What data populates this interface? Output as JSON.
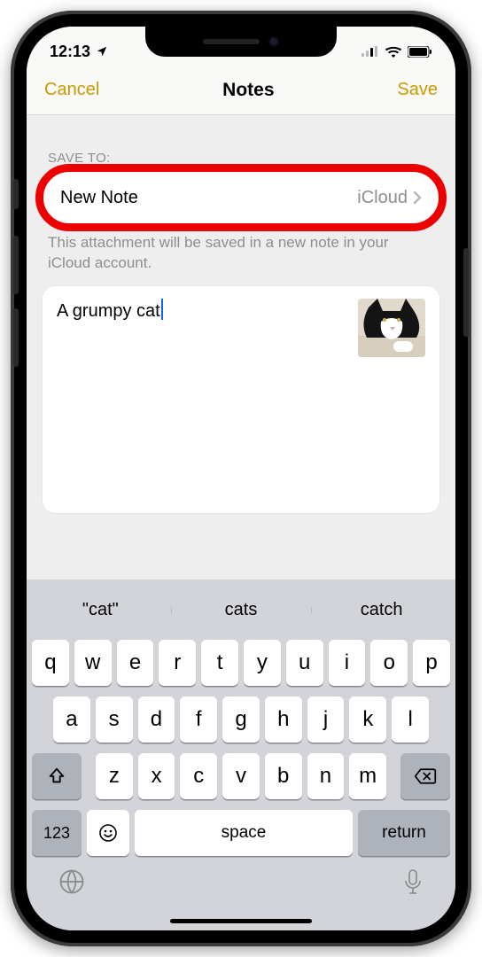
{
  "status": {
    "time": "12:13"
  },
  "nav": {
    "cancel": "Cancel",
    "title": "Notes",
    "save": "Save"
  },
  "saveTo": {
    "label": "SAVE TO:",
    "rowTitle": "New Note",
    "rowValue": "iCloud",
    "footnote": "This attachment will be saved in a new note in your iCloud account."
  },
  "note": {
    "text": "A grumpy cat"
  },
  "suggestions": [
    "\"cat\"",
    "cats",
    "catch"
  ],
  "keyboard": {
    "row1": [
      "q",
      "w",
      "e",
      "r",
      "t",
      "y",
      "u",
      "i",
      "o",
      "p"
    ],
    "row2": [
      "a",
      "s",
      "d",
      "f",
      "g",
      "h",
      "j",
      "k",
      "l"
    ],
    "row3": [
      "z",
      "x",
      "c",
      "v",
      "b",
      "n",
      "m"
    ],
    "numKey": "123",
    "space": "space",
    "return": "return"
  }
}
